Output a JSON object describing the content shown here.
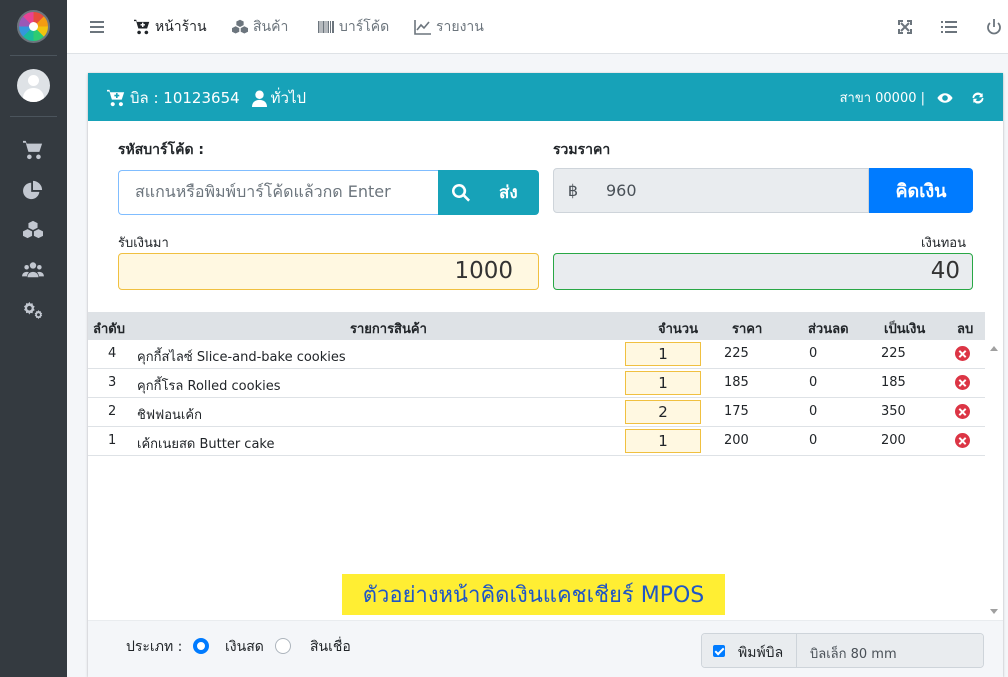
{
  "nav": {
    "items": [
      {
        "label": "หน้าร้าน",
        "active": true
      },
      {
        "label": "สินค้า",
        "active": false
      },
      {
        "label": "บาร์โค้ด",
        "active": false
      },
      {
        "label": "รายงาน",
        "active": false
      }
    ]
  },
  "bill": {
    "label": "บิล : 10123654",
    "customer": "ทั่วไป",
    "branch": "สาขา 00000 |"
  },
  "barcode": {
    "label": "รหัสบาร์โค้ด :",
    "placeholder": "สแกนหรือพิมพ์บาร์โค้ดแล้วกด Enter",
    "send_label": "ส่ง"
  },
  "total": {
    "label": "รวมราคา",
    "currency": "฿",
    "value": "960",
    "pay_label": "คิดเงิน"
  },
  "received": {
    "label": "รับเงินมา",
    "value": "1000"
  },
  "change": {
    "label": "เงินทอน",
    "value": "40"
  },
  "table": {
    "headers": [
      "ลำดับ",
      "รายการสินค้า",
      "จำนวน",
      "ราคา",
      "ส่วนลด",
      "เป็นเงิน",
      "ลบ"
    ],
    "rows": [
      {
        "no": "4",
        "name": "คุกกี้สไลซ์ Slice-and-bake cookies",
        "qty": "1",
        "price": "225",
        "discount": "0",
        "amount": "225"
      },
      {
        "no": "3",
        "name": "คุกกี้โรล Rolled cookies",
        "qty": "1",
        "price": "185",
        "discount": "0",
        "amount": "185"
      },
      {
        "no": "2",
        "name": "ชิฟฟอนเค้ก",
        "qty": "2",
        "price": "175",
        "discount": "0",
        "amount": "350"
      },
      {
        "no": "1",
        "name": "เค้กเนยสด Butter cake",
        "qty": "1",
        "price": "200",
        "discount": "0",
        "amount": "200"
      }
    ]
  },
  "banner": "ตัวอย่างหน้าคิดเงินแคชเชียร์ MPOS",
  "footer": {
    "type_label": "ประเภท :",
    "cash_label": "เงินสด",
    "credit_label": "สินเชื่อ",
    "selected": "cash",
    "print_label": "พิมพ์บิล",
    "print_size": "บิลเล็ก 80 mm"
  },
  "colors": {
    "header": "#17a2b8",
    "primary": "#007bff",
    "sidebar": "#343a40",
    "banner_bg": "#ffee33",
    "banner_text": "#1f56c6",
    "delete": "#dc3545"
  }
}
